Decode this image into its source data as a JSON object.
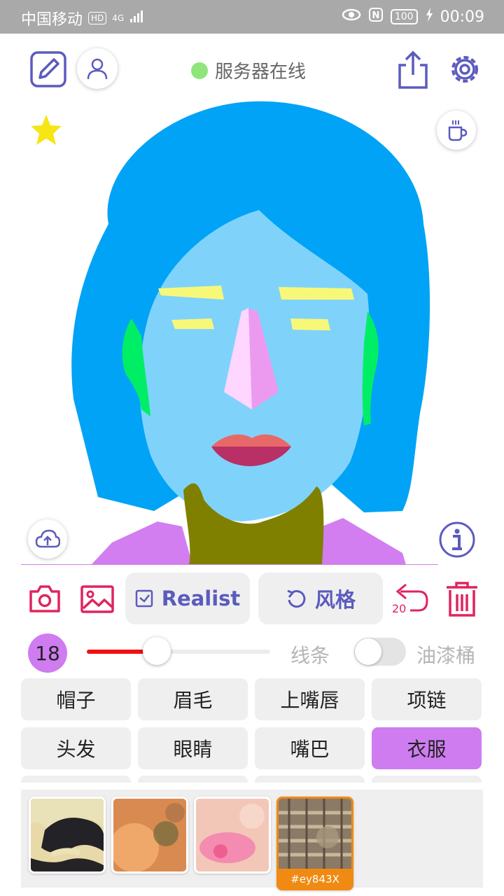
{
  "status_bar": {
    "carrier": "中国移动",
    "hd": "HD",
    "network": "4G",
    "battery": "100",
    "time": "00:09"
  },
  "header": {
    "server_status": "服务器在线",
    "server_status_color": "#8ee67a"
  },
  "toolbar": {
    "style_label": "Realist",
    "style_button": "风格",
    "undo_count": "20"
  },
  "brush": {
    "size": "18",
    "slider_level": 0.38,
    "line_label": "线条",
    "bucket_label": "油漆桶",
    "bucket_enabled": false
  },
  "parts": [
    {
      "label": "帽子",
      "active": false
    },
    {
      "label": "眉毛",
      "active": false
    },
    {
      "label": "上嘴唇",
      "active": false
    },
    {
      "label": "项链",
      "active": false
    },
    {
      "label": "头发",
      "active": false
    },
    {
      "label": "眼睛",
      "active": false
    },
    {
      "label": "嘴巴",
      "active": false
    },
    {
      "label": "衣服",
      "active": true
    }
  ],
  "textures": [
    {
      "selected": false
    },
    {
      "selected": false
    },
    {
      "selected": false
    },
    {
      "selected": true,
      "label": "#ey843X"
    }
  ],
  "colors": {
    "accent": "#5b5bbf",
    "selected_part": "#cf7cf0",
    "danger": "#e0245e",
    "hair": "#00a3f5",
    "skin": "#7fd3fb",
    "neck": "#808000",
    "clothes": "#d27ef0"
  }
}
